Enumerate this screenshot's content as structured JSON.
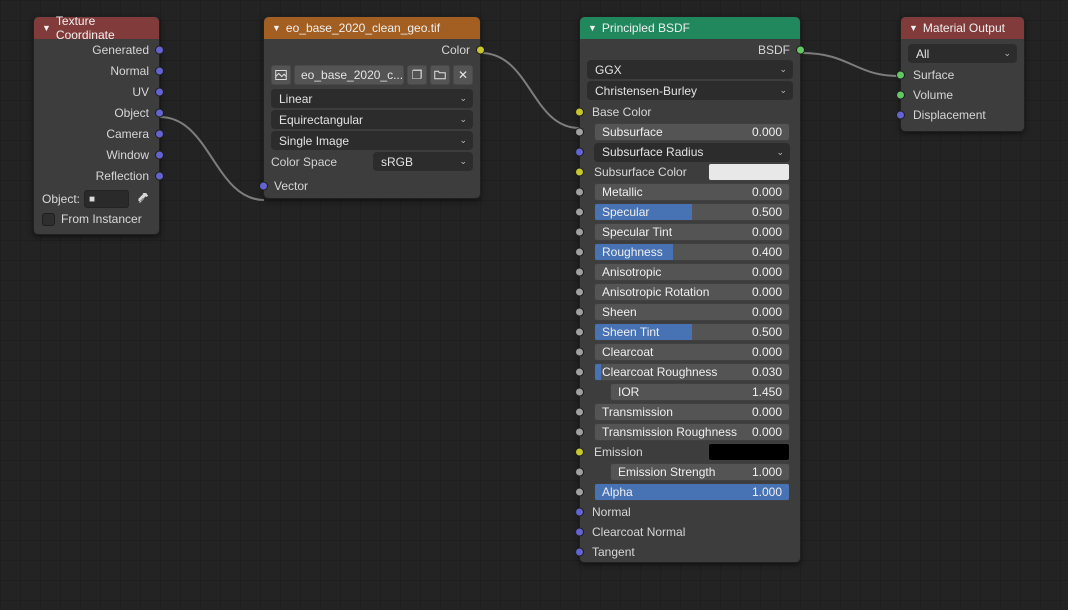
{
  "texCoord": {
    "title": "Texture Coordinate",
    "outputs": [
      "Generated",
      "Normal",
      "UV",
      "Object",
      "Camera",
      "Window",
      "Reflection"
    ],
    "objectLabel": "Object:",
    "fromInstancer": "From Instancer"
  },
  "imageNode": {
    "title": "eo_base_2020_clean_geo.tif",
    "filename": "eo_base_2020_c...",
    "interp": "Linear",
    "projection": "Equirectangular",
    "type": "Single Image",
    "colorSpaceLabel": "Color Space",
    "colorSpace": "sRGB",
    "outColor": "Color",
    "inVector": "Vector"
  },
  "bsdf": {
    "title": "Principled BSDF",
    "outBSDF": "BSDF",
    "distribution": "GGX",
    "subsurfMethod": "Christensen-Burley",
    "params": [
      {
        "label": "Base Color",
        "kind": "linkin",
        "soc": "color"
      },
      {
        "label": "Subsurface",
        "kind": "slider",
        "val": "0.000",
        "fill": 0
      },
      {
        "label": "Subsurface Radius",
        "kind": "dropdown",
        "soc": "vector"
      },
      {
        "label": "Subsurface Color",
        "kind": "swatch",
        "soc": "color",
        "color": "white"
      },
      {
        "label": "Metallic",
        "kind": "slider",
        "val": "0.000",
        "fill": 0
      },
      {
        "label": "Specular",
        "kind": "slider",
        "val": "0.500",
        "fill": 50
      },
      {
        "label": "Specular Tint",
        "kind": "slider",
        "val": "0.000",
        "fill": 0
      },
      {
        "label": "Roughness",
        "kind": "slider",
        "val": "0.400",
        "fill": 40
      },
      {
        "label": "Anisotropic",
        "kind": "slider",
        "val": "0.000",
        "fill": 0
      },
      {
        "label": "Anisotropic Rotation",
        "kind": "slider",
        "val": "0.000",
        "fill": 0
      },
      {
        "label": "Sheen",
        "kind": "slider",
        "val": "0.000",
        "fill": 0
      },
      {
        "label": "Sheen Tint",
        "kind": "slider",
        "val": "0.500",
        "fill": 50
      },
      {
        "label": "Clearcoat",
        "kind": "slider",
        "val": "0.000",
        "fill": 0
      },
      {
        "label": "Clearcoat Roughness",
        "kind": "slider",
        "val": "0.030",
        "fill": 3
      },
      {
        "label": "IOR",
        "kind": "slider",
        "val": "1.450",
        "fill": 0,
        "indent": true
      },
      {
        "label": "Transmission",
        "kind": "slider",
        "val": "0.000",
        "fill": 0
      },
      {
        "label": "Transmission Roughness",
        "kind": "slider",
        "val": "0.000",
        "fill": 0
      },
      {
        "label": "Emission",
        "kind": "swatch",
        "soc": "color",
        "color": "black"
      },
      {
        "label": "Emission Strength",
        "kind": "slider",
        "val": "1.000",
        "fill": 0,
        "indent": true
      },
      {
        "label": "Alpha",
        "kind": "slider",
        "val": "1.000",
        "fill": 100
      },
      {
        "label": "Normal",
        "kind": "linkin",
        "soc": "vector"
      },
      {
        "label": "Clearcoat Normal",
        "kind": "linkin",
        "soc": "vector"
      },
      {
        "label": "Tangent",
        "kind": "linkin",
        "soc": "vector"
      }
    ]
  },
  "matOutput": {
    "title": "Material Output",
    "target": "All",
    "inputs": [
      {
        "label": "Surface",
        "soc": "shader"
      },
      {
        "label": "Volume",
        "soc": "shader"
      },
      {
        "label": "Displacement",
        "soc": "vector"
      }
    ]
  }
}
